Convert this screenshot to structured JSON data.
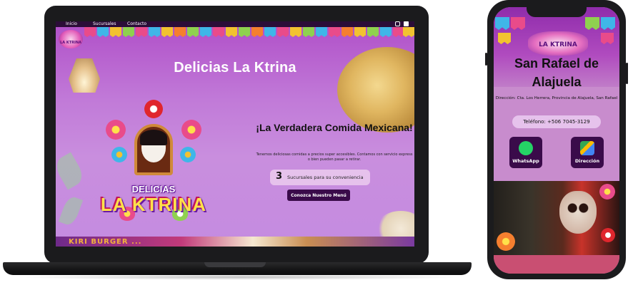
{
  "laptop": {
    "nav": {
      "items": [
        "Inicio",
        "Sucursales",
        "Contacto"
      ],
      "social_icons": [
        "instagram-icon",
        "facebook-icon"
      ]
    },
    "small_logo_text": "LA KTRINA",
    "hero_title": "Delicias La Ktrina",
    "logo": {
      "line1": "DELICIAS",
      "line2": "LA KTRINA"
    },
    "tagline": "¡La Verdadera Comida Mexicana!",
    "description": "Tenemos deliciosas comidas a precios super accesibles. Contamos con servicio express o bien pueden pasar a retirar.",
    "branches": {
      "count": "3",
      "label": "Sucursales para su conveniencia"
    },
    "menu_button": "Conozca Nuestro Menú",
    "bottom_banner": "KIRI BURGER ..."
  },
  "phone": {
    "logo_text": "LA KTRINA",
    "title": "San Rafael de Alajuela",
    "address": "Dirección: Cta. Los Herrera, Provincia de Alajuela, San Rafael",
    "phone": "Teléfono: +506 7045-3129",
    "buttons": [
      {
        "label": "WhatsApp",
        "icon": "whatsapp-icon",
        "color": "#25d366"
      },
      {
        "label": "Dirección",
        "icon": "map-icon",
        "color": "#4285f4"
      }
    ]
  },
  "colors": {
    "accent_dark": "#3a0b4a",
    "pill_bg": "#e6c2ec",
    "hero_purple": "#b04fc8"
  }
}
